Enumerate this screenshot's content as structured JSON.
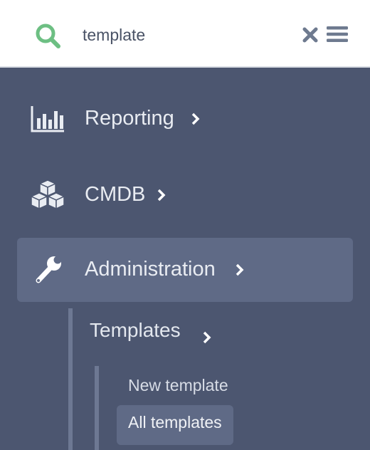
{
  "search": {
    "value": "template"
  },
  "icons": {
    "search": "search-icon",
    "clear": "close-icon",
    "menu": "hamburger-menu-icon",
    "reporting": "bar-chart-icon",
    "cmdb": "cubes-icon",
    "administration": "wrench-icon",
    "chevron": "chevron-right-icon"
  },
  "colors": {
    "search_accent": "#6dbf83",
    "sidebar_bg": "#4c5670",
    "active_bg": "#5f6a86",
    "topbar_bg": "#ffffff",
    "icon_gray": "#6e7a8f"
  },
  "nav": {
    "items": [
      {
        "label": "Reporting"
      },
      {
        "label": "CMDB"
      },
      {
        "label": "Administration"
      }
    ],
    "sub": {
      "label": "Templates"
    },
    "leaves": [
      {
        "label": "New template"
      },
      {
        "label": "All templates"
      }
    ]
  }
}
